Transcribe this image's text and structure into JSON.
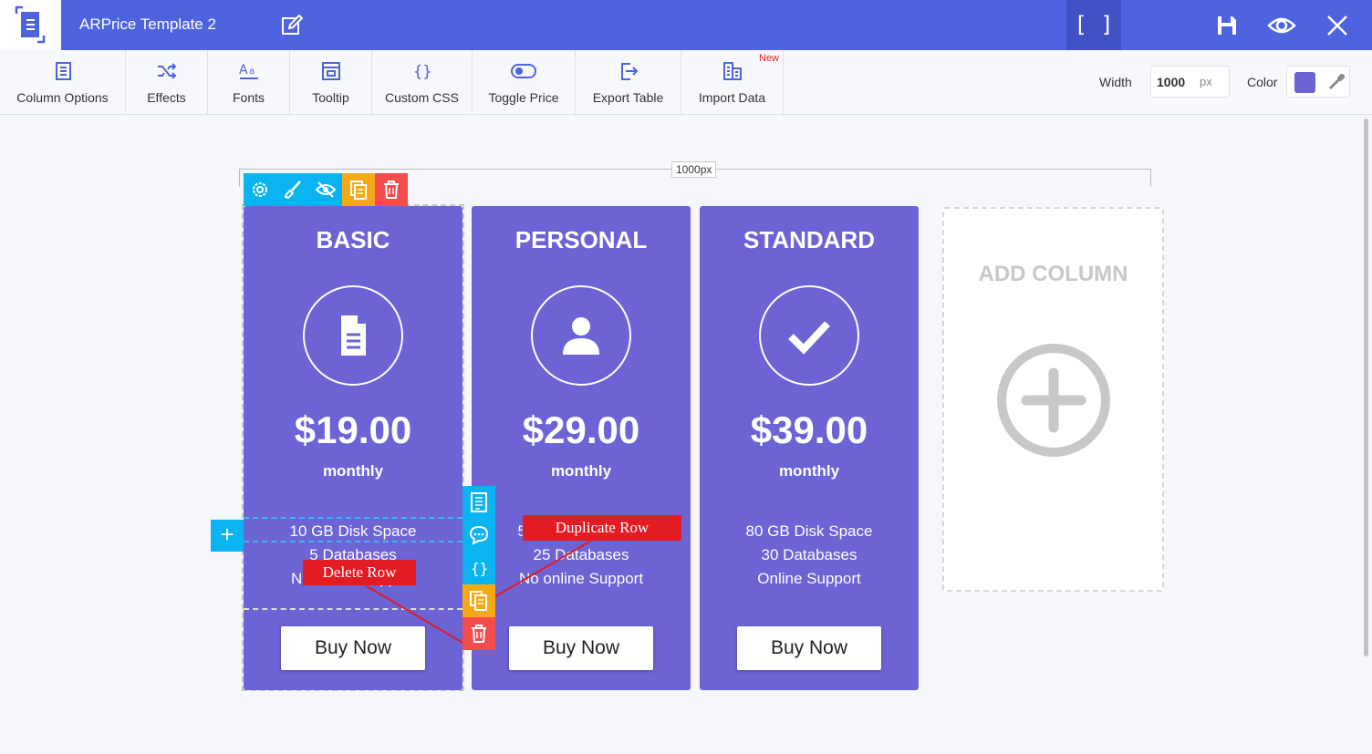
{
  "app": {
    "title": "ARPrice Template 2",
    "bracket_label": "[ ]",
    "accent": "#4e63e0",
    "icons": [
      "logo-icon",
      "edit-icon",
      "save-icon",
      "preview-eye-icon",
      "close-icon"
    ]
  },
  "toolbar": {
    "items": [
      {
        "label": "Column Options",
        "icon": "column-options-icon"
      },
      {
        "label": "Effects",
        "icon": "shuffle-icon"
      },
      {
        "label": "Fonts",
        "icon": "font-icon"
      },
      {
        "label": "Tooltip",
        "icon": "tooltip-icon"
      },
      {
        "label": "Custom CSS",
        "icon": "braces-icon"
      },
      {
        "label": "Toggle Price",
        "icon": "toggle-icon"
      },
      {
        "label": "Export Table",
        "icon": "export-icon"
      },
      {
        "label": "Import Data",
        "icon": "import-icon",
        "badge": "New"
      }
    ],
    "width_label": "Width",
    "width_value": "1000",
    "width_unit": "px",
    "color_label": "Color",
    "color_value": "#6c63d4"
  },
  "canvas": {
    "ruler_label": "1000px",
    "column_tools": [
      "settings-icon",
      "brush-icon",
      "hide-icon",
      "copy-icon",
      "trash-icon"
    ],
    "row_tools": [
      "row-description-icon",
      "row-tooltip-icon",
      "row-css-icon",
      "duplicate-row-icon",
      "delete-row-icon"
    ],
    "add_row_label": "+",
    "callouts": {
      "duplicate": "Duplicate Row",
      "delete": "Delete Row"
    },
    "add_column_label": "ADD COLUMN"
  },
  "plans": [
    {
      "name": "BASIC",
      "icon": "document-icon",
      "price": "$19.00",
      "period": "monthly",
      "features": [
        "10 GB Disk Space",
        "5 Databases",
        "No online Support"
      ],
      "button": "Buy Now"
    },
    {
      "name": "PERSONAL",
      "icon": "user-icon",
      "price": "$29.00",
      "period": "monthly",
      "features": [
        "50 GB Disk Space",
        "25 Databases",
        "No online Support"
      ],
      "button": "Buy Now"
    },
    {
      "name": "STANDARD",
      "icon": "checkmark-icon",
      "price": "$39.00",
      "period": "monthly",
      "features": [
        "80 GB Disk Space",
        "30 Databases",
        "Online Support"
      ],
      "button": "Buy Now"
    }
  ]
}
